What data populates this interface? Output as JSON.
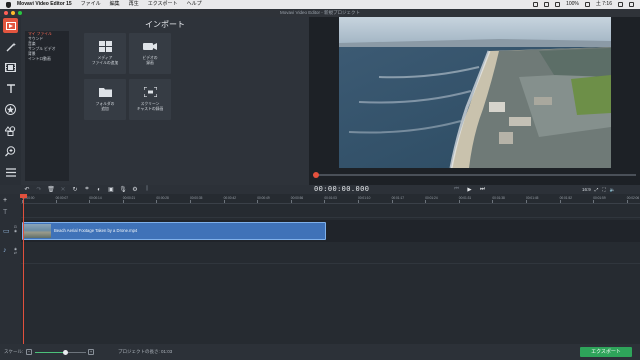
{
  "menubar": {
    "app_name": "Movavi Video Editor 15",
    "items": [
      "ファイル",
      "編集",
      "再生",
      "エクスポート",
      "ヘルプ"
    ],
    "right_status": "100%",
    "clock": "土 7:16"
  },
  "window": {
    "title": "Movavi Video Editor - 新規プロジェクト"
  },
  "import_panel": {
    "title": "インポート",
    "categories": [
      {
        "label": "マイ ファイル",
        "selected": true
      },
      {
        "label": "サウンド",
        "selected": false
      },
      {
        "label": "音楽",
        "selected": false
      },
      {
        "label": "サンプル ビデオ",
        "selected": false
      },
      {
        "label": "背景",
        "selected": false
      },
      {
        "label": "イントロ動画",
        "selected": false
      }
    ],
    "tiles": [
      {
        "line1": "メディア",
        "line2": "ファイルの追加",
        "icon": "media-grid-icon"
      },
      {
        "line1": "ビデオの",
        "line2": "録画",
        "icon": "camera-icon"
      },
      {
        "line1": "フォルダの",
        "line2": "追加",
        "icon": "folder-icon"
      },
      {
        "line1": "スクリーン",
        "line2": "キャストの録画",
        "icon": "screen-record-icon"
      }
    ]
  },
  "player": {
    "timecode": "00:00:00.000",
    "aspect_ratio": "16:9"
  },
  "timeline": {
    "ruler_ticks": [
      "00:00:00",
      "00:00:07",
      "00:00:14",
      "00:00:21",
      "00:00:28",
      "00:00:35",
      "00:00:42",
      "00:00:49",
      "00:00:56",
      "00:01:03",
      "00:01:10",
      "00:01:17",
      "00:01:24",
      "00:01:31",
      "00:01:38",
      "00:01:45",
      "00:01:52",
      "00:01:59",
      "00:02:06"
    ],
    "clip_label": "Beach Aerial Footage Taken by a Drone.mp4"
  },
  "statusbar": {
    "zoom_label": "スケール:",
    "zoom_fraction": 0.6,
    "project_duration": "プロジェクトの長さ: 01:03",
    "export_label": "エクスポート"
  },
  "colors": {
    "accent_red": "#e2553f",
    "export_green": "#2ea45a",
    "clip_blue": "#3f72b8"
  }
}
